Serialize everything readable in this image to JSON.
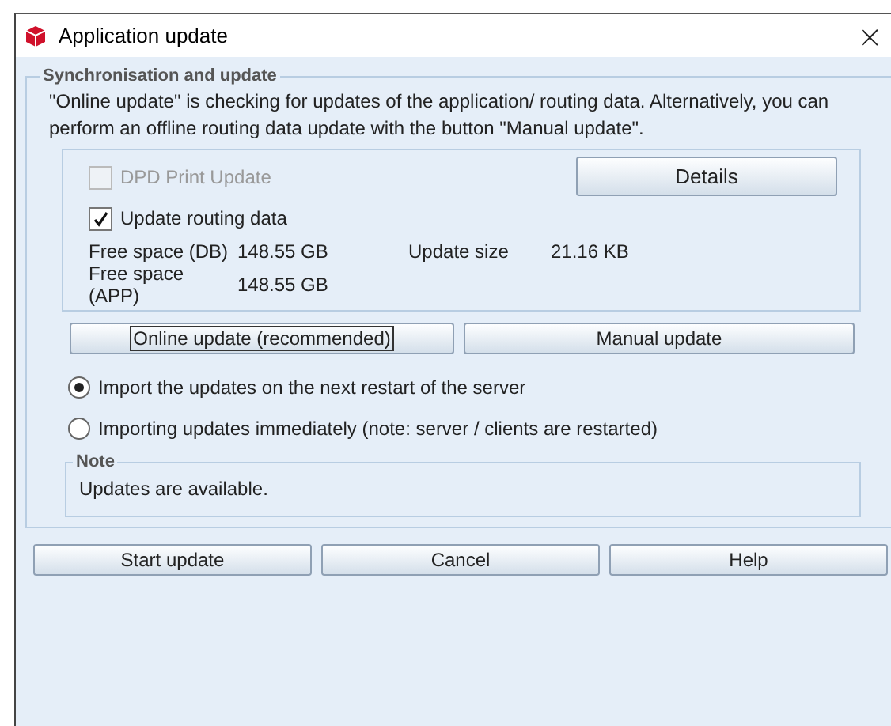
{
  "window": {
    "title": "Application update",
    "close": "×"
  },
  "sync_group": {
    "title": "Synchronisation and update",
    "description": "\"Online update\" is checking for updates of the application/ routing data. Alternatively, you can perform an offline routing data update with the button \"Manual update\".",
    "options": [
      {
        "label": "DPD Print Update",
        "checked": false,
        "disabled": true
      },
      {
        "label": "Update routing data",
        "checked": true,
        "disabled": false
      }
    ],
    "details_button": "Details",
    "info": [
      {
        "label": "Free space (DB)",
        "value": "148.55 GB",
        "extra_label": "Update size",
        "extra_value": "21.16 KB"
      },
      {
        "label": "Free space (APP)",
        "value": "148.55 GB"
      }
    ],
    "update_buttons": [
      {
        "label": "Online update (recommended)",
        "focused": true
      },
      {
        "label": "Manual update",
        "focused": false
      }
    ],
    "import_options": [
      {
        "label": "Import the updates on the next restart of the server",
        "selected": true
      },
      {
        "label": "Importing updates immediately (note: server / clients are restarted)",
        "selected": false
      }
    ],
    "note": {
      "title": "Note",
      "text": "Updates are available."
    }
  },
  "buttons": [
    "Start update",
    "Cancel",
    "Help"
  ]
}
